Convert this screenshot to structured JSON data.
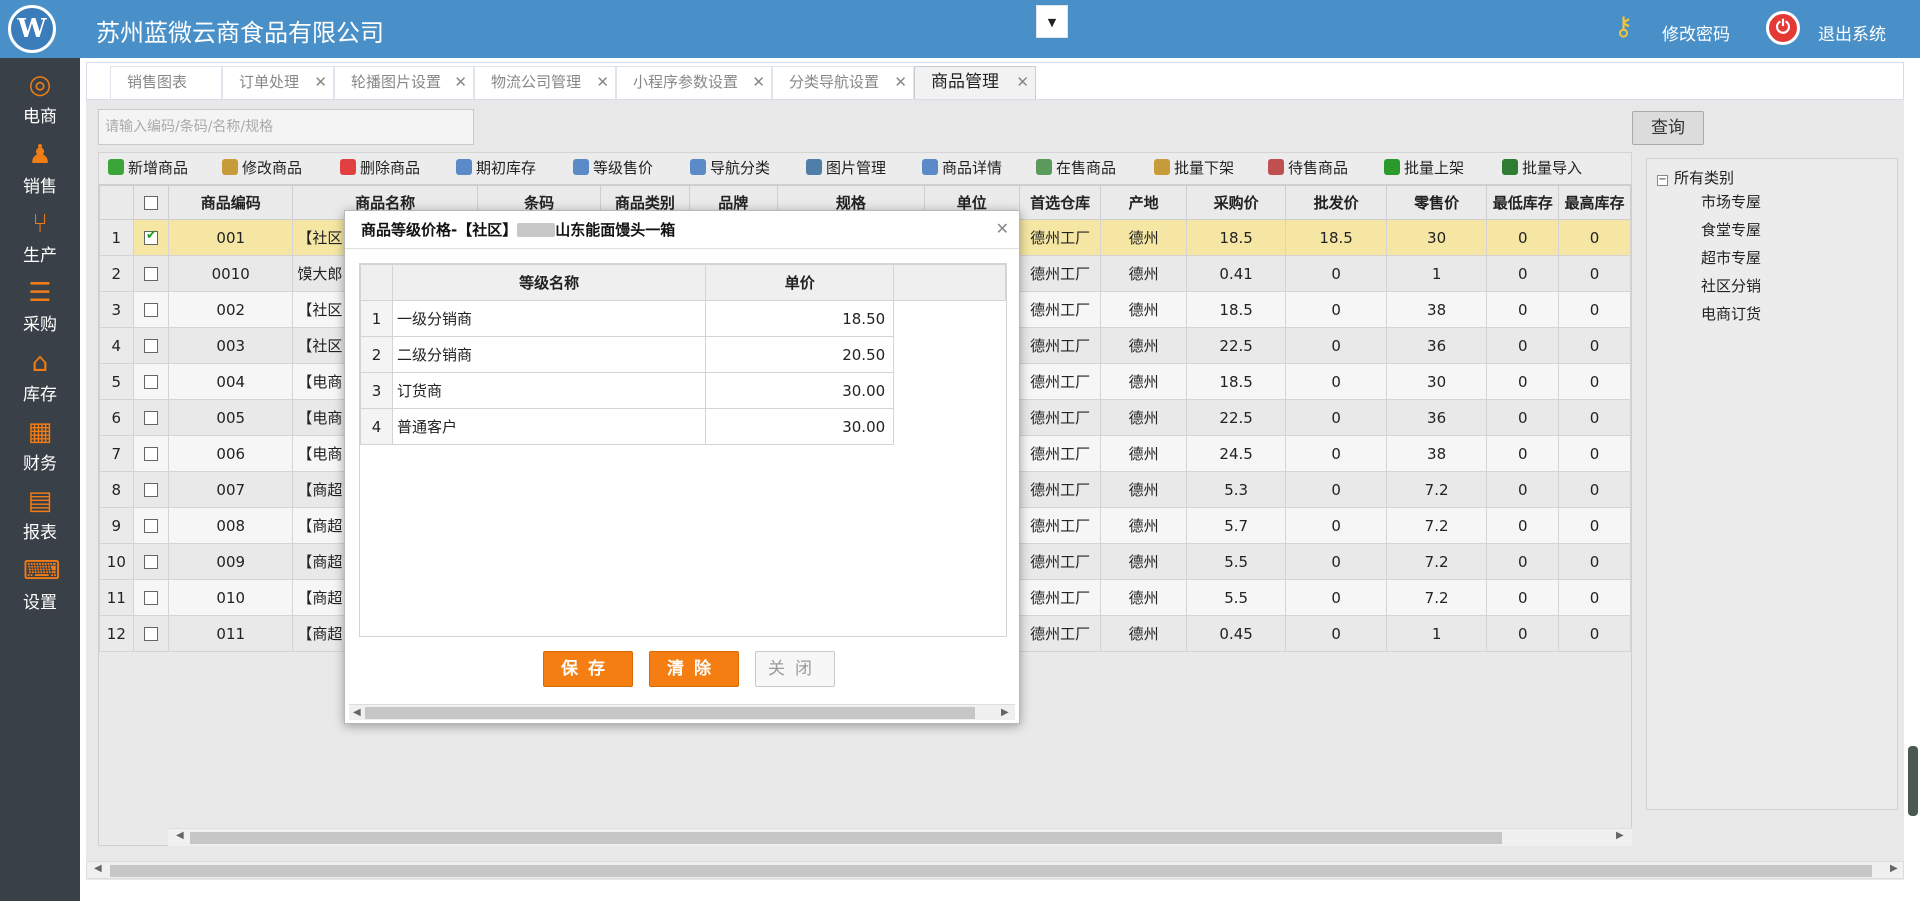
{
  "header": {
    "logo_text": "W",
    "company": "苏州蓝微云商食品有限公司",
    "change_password": "修改密码",
    "logout": "退出系统",
    "brand_color": "#4a90c8"
  },
  "sidebar": {
    "items": [
      {
        "label": "电商",
        "icon": "compass-icon",
        "glyph": "◎"
      },
      {
        "label": "销售",
        "icon": "user-icon",
        "glyph": "♟"
      },
      {
        "label": "生产",
        "icon": "fork-icon",
        "glyph": "⑂"
      },
      {
        "label": "采购",
        "icon": "cart-icon",
        "glyph": "☰"
      },
      {
        "label": "库存",
        "icon": "home-icon",
        "glyph": "⌂"
      },
      {
        "label": "财务",
        "icon": "calculator-icon",
        "glyph": "▦"
      },
      {
        "label": "报表",
        "icon": "report-icon",
        "glyph": "▤"
      },
      {
        "label": "设置",
        "icon": "keyboard-icon",
        "glyph": "⌨"
      }
    ]
  },
  "tabs": [
    {
      "label": "销售图表",
      "closable": false
    },
    {
      "label": "订单处理",
      "closable": true
    },
    {
      "label": "轮播图片设置",
      "closable": true
    },
    {
      "label": "物流公司管理",
      "closable": true
    },
    {
      "label": "小程序参数设置",
      "closable": true
    },
    {
      "label": "分类导航设置",
      "closable": true
    },
    {
      "label": "商品管理",
      "closable": true,
      "active": true
    }
  ],
  "search": {
    "placeholder": "请输入编码/条码/名称/规格",
    "button": "查询"
  },
  "toolbar": [
    {
      "label": "新增商品",
      "icon": "add-icon",
      "color": "#3aa63a"
    },
    {
      "label": "修改商品",
      "icon": "edit-icon",
      "color": "#c79a3a"
    },
    {
      "label": "删除商品",
      "icon": "delete-icon",
      "color": "#e04040"
    },
    {
      "label": "期初库存",
      "icon": "table-icon",
      "color": "#5b8ac9"
    },
    {
      "label": "等级售价",
      "icon": "table-icon",
      "color": "#5b8ac9"
    },
    {
      "label": "导航分类",
      "icon": "table-icon",
      "color": "#5b8ac9"
    },
    {
      "label": "图片管理",
      "icon": "image-icon",
      "color": "#4f7fa8"
    },
    {
      "label": "商品详情",
      "icon": "table-icon",
      "color": "#5b8ac9"
    },
    {
      "label": "在售商品",
      "icon": "calendar-icon",
      "color": "#5a9a5a"
    },
    {
      "label": "批量下架",
      "icon": "down-shelf-icon",
      "color": "#c79a3a"
    },
    {
      "label": "待售商品",
      "icon": "calendar-icon",
      "color": "#c05050"
    },
    {
      "label": "批量上架",
      "icon": "check-icon",
      "color": "#2a9a2a"
    },
    {
      "label": "批量导入",
      "icon": "excel-icon",
      "color": "#2e7d32"
    }
  ],
  "grid": {
    "columns": [
      "商品编码",
      "商品名称",
      "条码",
      "商品类别",
      "品牌",
      "规格",
      "单位",
      "首选仓库",
      "产地",
      "采购价",
      "批发价",
      "零售价",
      "最低库存",
      "最高库存"
    ],
    "rows": [
      {
        "n": "1",
        "checked": true,
        "code": "001",
        "name": "【社区",
        "wh": "德州工厂",
        "origin": "德州",
        "buy": "18.5",
        "whole": "18.5",
        "retail": "30",
        "min": "0",
        "max": "0"
      },
      {
        "n": "2",
        "checked": false,
        "code": "0010",
        "name": "馍大郎",
        "wh": "德州工厂",
        "origin": "德州",
        "buy": "0.41",
        "whole": "0",
        "retail": "1",
        "min": "0",
        "max": "0"
      },
      {
        "n": "3",
        "checked": false,
        "code": "002",
        "name": "【社区",
        "wh": "德州工厂",
        "origin": "德州",
        "buy": "18.5",
        "whole": "0",
        "retail": "38",
        "min": "0",
        "max": "0"
      },
      {
        "n": "4",
        "checked": false,
        "code": "003",
        "name": "【社区",
        "wh": "德州工厂",
        "origin": "德州",
        "buy": "22.5",
        "whole": "0",
        "retail": "36",
        "min": "0",
        "max": "0"
      },
      {
        "n": "5",
        "checked": false,
        "code": "004",
        "name": "【电商",
        "wh": "德州工厂",
        "origin": "德州",
        "buy": "18.5",
        "whole": "0",
        "retail": "30",
        "min": "0",
        "max": "0"
      },
      {
        "n": "6",
        "checked": false,
        "code": "005",
        "name": "【电商",
        "wh": "德州工厂",
        "origin": "德州",
        "buy": "22.5",
        "whole": "0",
        "retail": "36",
        "min": "0",
        "max": "0"
      },
      {
        "n": "7",
        "checked": false,
        "code": "006",
        "name": "【电商",
        "wh": "德州工厂",
        "origin": "德州",
        "buy": "24.5",
        "whole": "0",
        "retail": "38",
        "min": "0",
        "max": "0"
      },
      {
        "n": "8",
        "checked": false,
        "code": "007",
        "name": "【商超",
        "wh": "德州工厂",
        "origin": "德州",
        "buy": "5.3",
        "whole": "0",
        "retail": "7.2",
        "min": "0",
        "max": "0"
      },
      {
        "n": "9",
        "checked": false,
        "code": "008",
        "name": "【商超",
        "wh": "德州工厂",
        "origin": "德州",
        "buy": "5.7",
        "whole": "0",
        "retail": "7.2",
        "min": "0",
        "max": "0"
      },
      {
        "n": "10",
        "checked": false,
        "code": "009",
        "name": "【商超",
        "wh": "德州工厂",
        "origin": "德州",
        "buy": "5.5",
        "whole": "0",
        "retail": "7.2",
        "min": "0",
        "max": "0"
      },
      {
        "n": "11",
        "checked": false,
        "code": "010",
        "name": "【商超",
        "wh": "德州工厂",
        "origin": "德州",
        "buy": "5.5",
        "whole": "0",
        "retail": "7.2",
        "min": "0",
        "max": "0"
      },
      {
        "n": "12",
        "checked": false,
        "code": "011",
        "name": "【商超",
        "wh": "德州工厂",
        "origin": "德州",
        "buy": "0.45",
        "whole": "0",
        "retail": "1",
        "min": "0",
        "max": "0"
      }
    ]
  },
  "tree": {
    "root": "所有类别",
    "nodes": [
      "市场专屋",
      "食堂专屋",
      "超市专屋",
      "社区分销",
      "电商订货"
    ]
  },
  "dialog": {
    "title_prefix": "商品等级价格-【社区】",
    "title_suffix": "山东能面馒头一箱",
    "columns": [
      "等级名称",
      "单价"
    ],
    "rows": [
      {
        "n": "1",
        "name": "一级分销商",
        "price": "18.50"
      },
      {
        "n": "2",
        "name": "二级分销商",
        "price": "20.50"
      },
      {
        "n": "3",
        "name": "订货商",
        "price": "30.00"
      },
      {
        "n": "4",
        "name": "普通客户",
        "price": "30.00"
      }
    ],
    "save": "保存",
    "clear": "清除",
    "close": "关闭",
    "accent": "#f47e11"
  }
}
